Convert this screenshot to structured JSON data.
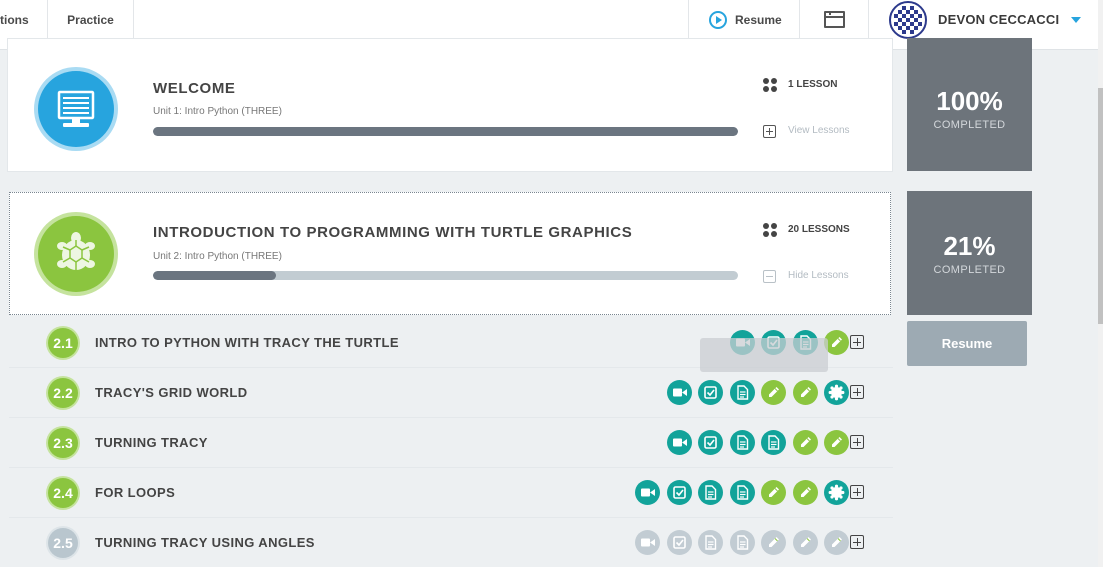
{
  "nav": {
    "tabs": [
      {
        "label": "tions"
      },
      {
        "label": "Practice"
      }
    ],
    "resume_label": "Resume",
    "user_name": "DEVON CECCACCI"
  },
  "units": [
    {
      "title": "WELCOME",
      "subtitle": "Unit 1: Intro Python (THREE)",
      "lesson_count": "1 LESSON",
      "toggle_label": "View Lessons",
      "progress": 1.0,
      "completion_pct": "100%",
      "completion_label": "COMPLETED",
      "icon": "monitor-icon",
      "color": "#27a4de"
    },
    {
      "title": "INTRODUCTION TO PROGRAMMING WITH TURTLE GRAPHICS",
      "subtitle": "Unit 2: Intro Python (THREE)",
      "lesson_count": "20 LESSONS",
      "toggle_label": "Hide Lessons",
      "progress": 0.21,
      "completion_pct": "21%",
      "completion_label": "COMPLETED",
      "resume_label": "Resume",
      "icon": "turtle-icon",
      "color": "#8bc53f"
    }
  ],
  "lessons": [
    {
      "num": "2.1",
      "title": "INTRO TO PYTHON WITH TRACY THE TURTLE",
      "locked": false,
      "activities": [
        [
          "video",
          "teal"
        ],
        [
          "quiz",
          "teal"
        ],
        [
          "doc",
          "teal"
        ],
        [
          "exercise",
          "green"
        ]
      ]
    },
    {
      "num": "2.2",
      "title": "TRACY'S GRID WORLD",
      "locked": false,
      "activities": [
        [
          "video",
          "teal"
        ],
        [
          "quiz",
          "teal"
        ],
        [
          "doc",
          "teal"
        ],
        [
          "exercise",
          "green"
        ],
        [
          "exercise",
          "green"
        ],
        [
          "badge",
          "teal"
        ]
      ]
    },
    {
      "num": "2.3",
      "title": "TURNING TRACY",
      "locked": false,
      "activities": [
        [
          "video",
          "teal"
        ],
        [
          "quiz",
          "teal"
        ],
        [
          "doc",
          "teal"
        ],
        [
          "doc",
          "teal"
        ],
        [
          "exercise",
          "green"
        ],
        [
          "exercise",
          "green"
        ]
      ]
    },
    {
      "num": "2.4",
      "title": "FOR LOOPS",
      "locked": false,
      "activities": [
        [
          "video",
          "teal"
        ],
        [
          "quiz",
          "teal"
        ],
        [
          "doc",
          "teal"
        ],
        [
          "doc",
          "teal"
        ],
        [
          "exercise",
          "green"
        ],
        [
          "exercise",
          "green"
        ],
        [
          "badge",
          "teal"
        ]
      ]
    },
    {
      "num": "2.5",
      "title": "TURNING TRACY USING ANGLES",
      "locked": true,
      "activities": [
        [
          "video",
          "grey"
        ],
        [
          "quiz",
          "grey"
        ],
        [
          "doc",
          "grey"
        ],
        [
          "doc",
          "grey"
        ],
        [
          "exercise",
          "grey"
        ],
        [
          "exercise",
          "grey"
        ],
        [
          "exercise",
          "grey"
        ]
      ]
    }
  ]
}
